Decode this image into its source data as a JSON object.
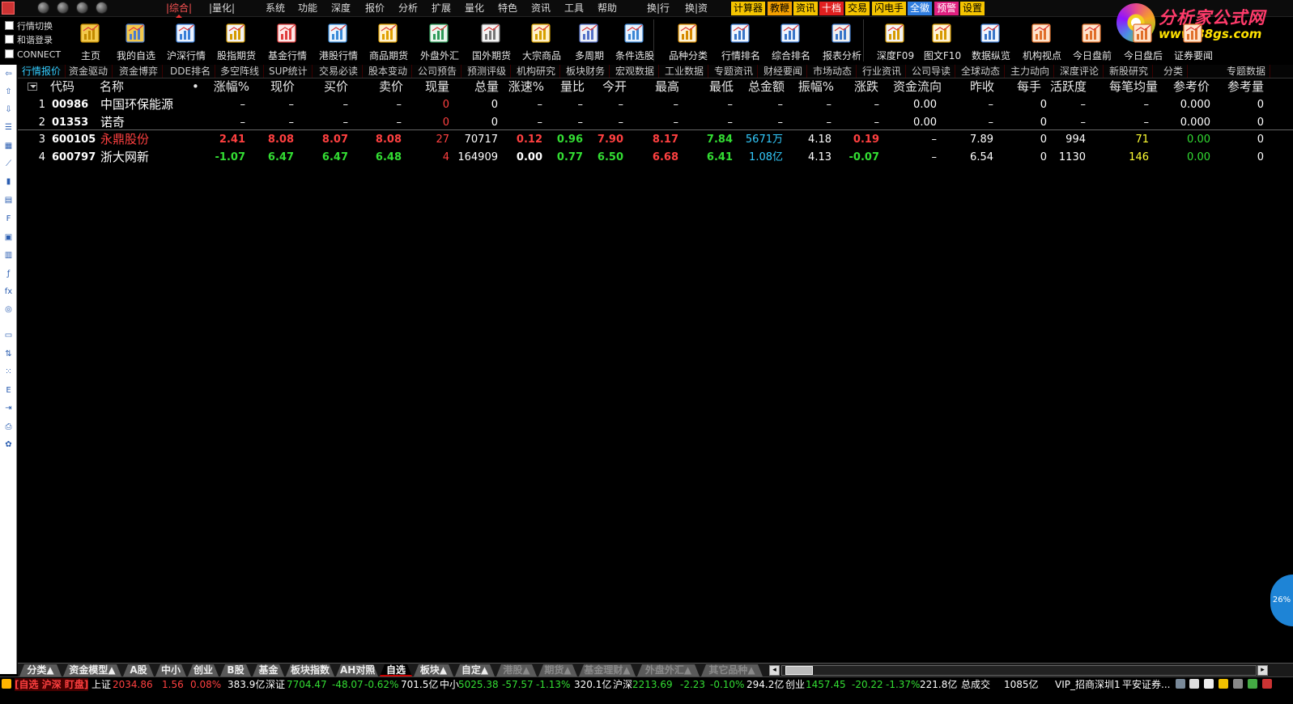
{
  "titlebar": {
    "menus": [
      "|综合|",
      "|量化|",
      "系统",
      "功能",
      "深度",
      "报价",
      "分析",
      "扩展",
      "量化",
      "特色",
      "资讯",
      "工具",
      "帮助",
      "换|行",
      "换|资"
    ],
    "buttons": [
      {
        "label": "计算器",
        "color": "#f5c400"
      },
      {
        "label": "教鞭",
        "color": "#f5a000"
      },
      {
        "label": "资讯",
        "color": "#f5c400"
      },
      {
        "label": "十档",
        "color": "#e02020"
      },
      {
        "label": "交易",
        "color": "#f5c400"
      },
      {
        "label": "闪电手",
        "color": "#f5c400"
      },
      {
        "label": "全徽",
        "color": "#2f7de0"
      },
      {
        "label": "预警",
        "color": "#e02080"
      },
      {
        "label": "设置",
        "color": "#f5c400"
      }
    ]
  },
  "brand": {
    "name": "分析家公式网",
    "url": "www.88gs.com"
  },
  "options": [
    "行情切换",
    "和谐登录",
    "CONNECT"
  ],
  "toolbar": [
    "主页",
    "我的自选",
    "沪深行情",
    "股指期货",
    "基金行情",
    "港股行情",
    "商品期货",
    "外盘外汇",
    "国外期货",
    "大宗商品",
    "多周期",
    "条件选股",
    "品种分类",
    "行情排名",
    "综合排名",
    "报表分析",
    "深度F09",
    "图文F10",
    "数据纵览",
    "机构视点",
    "今日盘前",
    "今日盘后",
    "证券要闻"
  ],
  "f10_tabs": [
    "行情报价",
    "资金驱动",
    "资金博弈",
    "DDE排名",
    "多空阵线",
    "SUP统计",
    "交易必读",
    "股本变动",
    "公司预告",
    "预测评级",
    "机构研究",
    "板块财务",
    "宏观数据",
    "工业数据",
    "专题资讯",
    "财经要闻",
    "市场动态",
    "行业资讯",
    "公司导读",
    "全球动态",
    "主力动向",
    "深度评论",
    "新股研究",
    "分类",
    "专题数据"
  ],
  "table": {
    "headers": [
      "代码",
      "名称",
      "•",
      "涨幅%",
      "现价",
      "买价",
      "卖价",
      "现量",
      "总量",
      "涨速%",
      "量比",
      "今开",
      "最高",
      "最低",
      "总金额",
      "振幅%",
      "涨跌",
      "资金流向",
      "昨收",
      "每手",
      "活跃度",
      "每笔均量",
      "参考价",
      "参考量"
    ],
    "rows": [
      {
        "idx": "1",
        "code": "00986",
        "name": "中国环保能源",
        "cells": [
          "–",
          "–",
          "–",
          "–",
          "0",
          "0",
          "–",
          "–",
          "–",
          "–",
          "–",
          "–",
          "–",
          "–",
          "0.00",
          "–",
          "0",
          "–",
          "–",
          "0.000",
          "0"
        ]
      },
      {
        "idx": "2",
        "code": "01353",
        "name": "诺奇",
        "cells": [
          "–",
          "–",
          "–",
          "–",
          "0",
          "0",
          "–",
          "–",
          "–",
          "–",
          "–",
          "–",
          "–",
          "–",
          "0.00",
          "–",
          "0",
          "–",
          "–",
          "0.000",
          "0"
        ]
      },
      {
        "idx": "3",
        "code": "600105",
        "name": "永鼎股份",
        "cells": [
          "2.41",
          "8.08",
          "8.07",
          "8.08",
          "27",
          "70717",
          "0.12",
          "0.96",
          "7.90",
          "8.17",
          "7.84",
          "5671万",
          "4.18",
          "0.19",
          "–",
          "7.89",
          "0",
          "994",
          "71",
          "0.00",
          "0"
        ]
      },
      {
        "idx": "4",
        "code": "600797",
        "name": "浙大网新",
        "cells": [
          "-1.07",
          "6.47",
          "6.47",
          "6.48",
          "4",
          "164909",
          "0.00",
          "0.77",
          "6.50",
          "6.68",
          "6.41",
          "1.08亿",
          "4.13",
          "-0.07",
          "–",
          "6.54",
          "0",
          "1130",
          "146",
          "0.00",
          "0"
        ]
      }
    ]
  },
  "sheet_tabs": [
    {
      "label": "分类▲",
      "dim": false
    },
    {
      "label": "资金模型▲",
      "dim": false
    },
    {
      "label": "A股",
      "dim": false
    },
    {
      "label": "中小",
      "dim": false
    },
    {
      "label": "创业",
      "dim": false
    },
    {
      "label": "B股",
      "dim": false
    },
    {
      "label": "基金",
      "dim": false
    },
    {
      "label": "板块指数",
      "dim": false
    },
    {
      "label": "AH对照",
      "dim": false
    },
    {
      "label": "自选",
      "dim": false,
      "active": true
    },
    {
      "label": "板块▲",
      "dim": false
    },
    {
      "label": "自定▲",
      "dim": false
    },
    {
      "label": "港股▲",
      "dim": true
    },
    {
      "label": "期货▲",
      "dim": true
    },
    {
      "label": "基金理财▲",
      "dim": true
    },
    {
      "label": "外盘外汇▲",
      "dim": true
    },
    {
      "label": "其它品种▲",
      "dim": true
    }
  ],
  "statusbar": {
    "mode": "[自选 沪深 盯盘]",
    "sh_label": "上证",
    "sh_index": "2034.86",
    "sh_chg": "1.56",
    "sh_pct": "0.08%",
    "sh_amt": "383.9亿",
    "sz_label": "深证",
    "sz_index": "7704.47",
    "sz_chg": "-48.07",
    "sz_pct": "-0.62%",
    "sz_amt": "701.5亿",
    "zx_label": "中小",
    "zx_index": "5025.38",
    "zx_chg": "-57.57",
    "zx_pct": "-1.13%",
    "zx_amt": "320.1亿",
    "hs_label": "沪深",
    "hs_index": "2213.69",
    "hs_chg": "-2.23",
    "hs_pct": "-0.10%",
    "hs_amt": "294.2亿",
    "cy_label": "创业",
    "cy_index": "1457.45",
    "cy_chg": "-20.22",
    "cy_pct": "-1.37%",
    "cy_amt": "221.8亿",
    "total_label": "总成交",
    "total_val": "1085亿",
    "server": "VIP_招商深圳1",
    "broker": "平安证券..."
  },
  "float_badge": "26%",
  "colors": {
    "up": "#ff4040",
    "down": "#33dd33",
    "flat": "#ffffff",
    "yellow": "#ffff33",
    "cyan": "#33ccff",
    "code": "#ffffff"
  }
}
